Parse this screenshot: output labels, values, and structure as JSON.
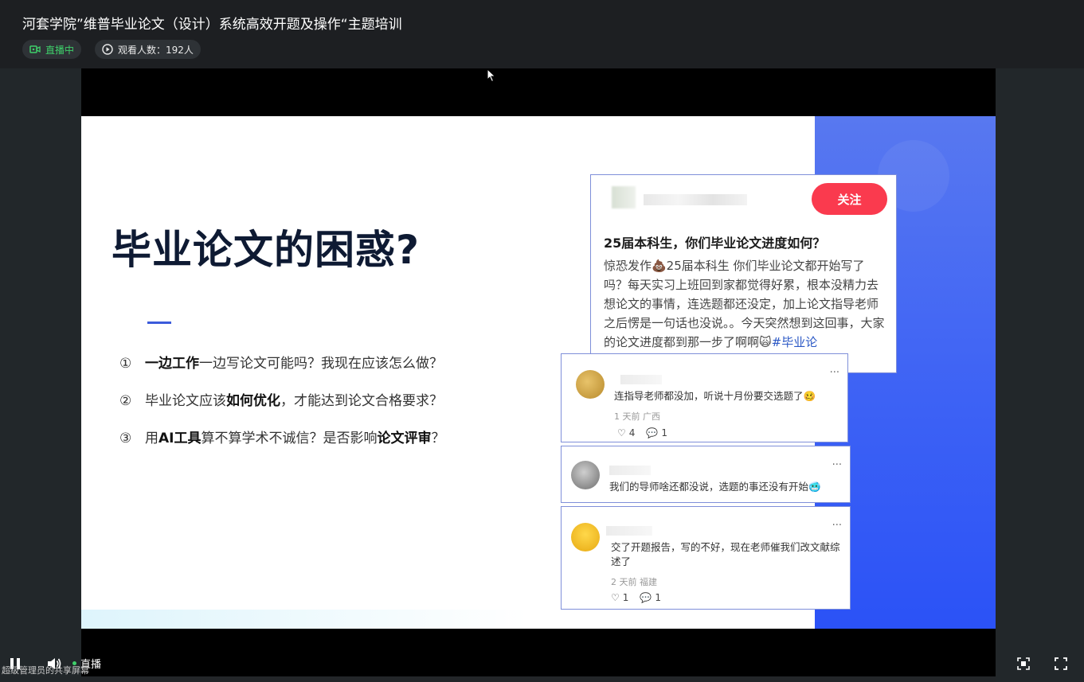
{
  "header": {
    "title": "河套学院”维普毕业论文（设计）系统高效开题及操作“主题培训",
    "live_label": "直播中",
    "viewers_label": "观看人数：192人"
  },
  "slide": {
    "title": "毕业论文的困惑?",
    "bullets": [
      {
        "num": "①",
        "b1": "一边工作",
        "t1": "一边写论文可能吗？我现在应该怎么做？",
        "b2": "",
        "t2": ""
      },
      {
        "num": "②",
        "t0": "毕业论文应该",
        "b1": "如何优化",
        "t1": "，才能达到论文合格要求？"
      },
      {
        "num": "③",
        "t0": "用",
        "b1": "AI工具",
        "t1": "算不算学术不诚信？是否影响",
        "b2": "论文评审",
        "t2": "？"
      }
    ]
  },
  "post": {
    "follow_label": "关注",
    "title": "25届本科生，你们毕业论文进度如何？",
    "body": "惊恐发作💩25届本科生 你们毕业论文都开始写了吗？每天实习上班回到家都觉得好累，根本没精力去想论文的事情，连选题都还没定，加上论文指导老师之后愣是一句话也没说。。今天突然想到这回事，大家的论文进度都到那一步了啊啊🙀",
    "tag": "#毕业论"
  },
  "comments": [
    {
      "text": "连指导老师都没加，听说十月份要交选题了🥴",
      "meta": "1 天前 广西",
      "likes": "4",
      "replies": "1"
    },
    {
      "text": "我们的导师啥还都没说，选题的事还没有开始🥶",
      "meta": "",
      "likes": "",
      "replies": ""
    },
    {
      "text": "交了开题报告，写的不好，现在老师催我们改文献综述了",
      "meta": "2 天前 福建",
      "likes": "1",
      "replies": "1"
    }
  ],
  "controls": {
    "live_label": "直播",
    "share_note": "超级管理员的共享屏幕"
  },
  "icons": {
    "live": "video-camera-icon",
    "viewers": "play-circle-icon",
    "pause": "pause-icon",
    "volume": "volume-icon",
    "screenshot": "screenshot-icon",
    "fullscreen": "fullscreen-icon"
  },
  "colors": {
    "live_green": "#3fcf6a",
    "follow_red": "#fa3a4e",
    "slide_blue": "#3d62f5"
  }
}
